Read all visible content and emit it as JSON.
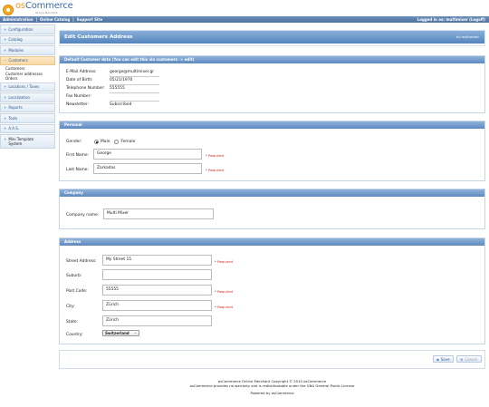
{
  "brand": {
    "logo_main_os": "os",
    "logo_main_rest": "Commerce",
    "logo_sub": "Online Merchant"
  },
  "topbar": {
    "links": [
      "Administration",
      "Online Catalog",
      "Support Site"
    ],
    "logged_in": "Logged in as: multimixer (Logoff)"
  },
  "sidebar": {
    "items": [
      {
        "label": "Configuration"
      },
      {
        "label": "Catalog"
      },
      {
        "label": "Modules"
      },
      {
        "label": "Customers",
        "active": true,
        "sub": [
          "Customers",
          "Customer addresses",
          "Orders"
        ]
      },
      {
        "label": "Locations / Taxes"
      },
      {
        "label": "Localization"
      },
      {
        "label": "Reports"
      },
      {
        "label": "Tools"
      },
      {
        "label": "A.A.S."
      },
      {
        "label": "Mini Template System"
      }
    ]
  },
  "page": {
    "title": "Edit Customers Address",
    "by": "by multimixer"
  },
  "default_data": {
    "header": "Default Customer data (You can edit this via customers -> edit)",
    "rows": [
      {
        "label": "E-Mail Address:",
        "value": "george@multimixer.gr"
      },
      {
        "label": "Date of Birth:",
        "value": "05/21/1970"
      },
      {
        "label": "Telephone Number:",
        "value": "555555"
      },
      {
        "label": "Fax Number:",
        "value": ""
      },
      {
        "label": "Newsletter:",
        "value": "Subscribed"
      }
    ]
  },
  "personal": {
    "header": "Personal",
    "gender_label": "Gender:",
    "gender_male": "Male",
    "gender_female": "Female",
    "first_name_label": "First Name:",
    "first_name": "George",
    "last_name_label": "Last Name:",
    "last_name": "Zarkadas",
    "required": "* Required"
  },
  "company": {
    "header": "Company",
    "label": "Company name:",
    "value": "Multi Mixer"
  },
  "address": {
    "header": "Address",
    "street_label": "Street Address:",
    "street": "My Street 15",
    "suburb_label": "Suburb:",
    "suburb": "",
    "post_label": "Post Code:",
    "post": "55555",
    "city_label": "City:",
    "city": "Zürich",
    "state_label": "State:",
    "state": "Zürich",
    "country_label": "Country:",
    "country": "Switzerland",
    "required": "* Required"
  },
  "actions": {
    "save": "Save",
    "cancel": "Cancel"
  },
  "footer": {
    "line1": "osCommerce Online Merchant Copyright © 2010 osCommerce",
    "line2": "osCommerce provides no warranty and is redistributable under the GNU General Public License",
    "line3": "Powered by osCommerce"
  }
}
